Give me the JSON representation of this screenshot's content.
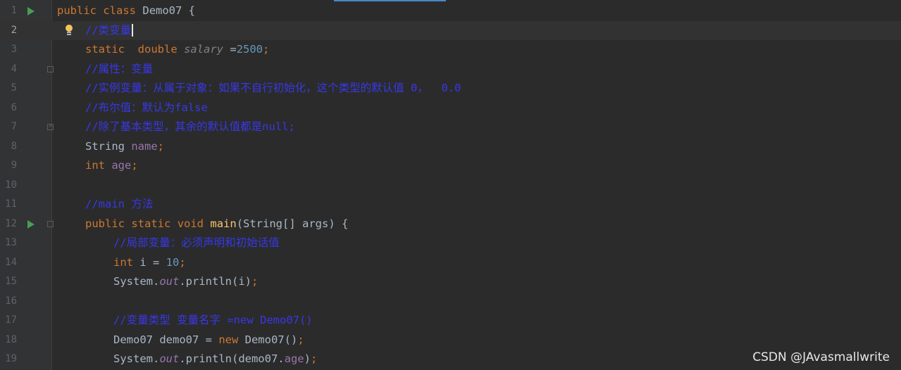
{
  "editor": {
    "current_line": 2,
    "lines": [
      {
        "n": "1"
      },
      {
        "n": "2"
      },
      {
        "n": "3"
      },
      {
        "n": "4"
      },
      {
        "n": "5"
      },
      {
        "n": "6"
      },
      {
        "n": "7"
      },
      {
        "n": "8"
      },
      {
        "n": "9"
      },
      {
        "n": "10"
      },
      {
        "n": "11"
      },
      {
        "n": "12"
      },
      {
        "n": "13"
      },
      {
        "n": "14"
      },
      {
        "n": "15"
      },
      {
        "n": "16"
      },
      {
        "n": "17"
      },
      {
        "n": "18"
      },
      {
        "n": "19"
      }
    ],
    "tokens": {
      "l1": [
        "public",
        "class",
        "Demo07 {"
      ],
      "l2": [
        "//类变量"
      ],
      "l3": [
        "static",
        "double",
        "salary",
        " =",
        "2500",
        ";"
      ],
      "l4": [
        "//属性：变量"
      ],
      "l5": [
        "//实例变量：从属于对象：如果不自行初始化，这个类型的默认值 0，  0.0"
      ],
      "l6": [
        "//布尔值：默认为false"
      ],
      "l7": [
        "//除了基本类型，其余的默认值都是null;"
      ],
      "l8": [
        "String ",
        "name",
        ";"
      ],
      "l9": [
        "int",
        "age",
        ";"
      ],
      "l11": [
        "//main 方法"
      ],
      "l12": [
        "public",
        "static",
        "void",
        "main",
        "(String[] args) {"
      ],
      "l13": [
        "//局部变量：必须声明和初始话值"
      ],
      "l14": [
        "int",
        "i = ",
        "10",
        ";"
      ],
      "l15": [
        "System.",
        "out",
        ".println(i)",
        ";"
      ],
      "l17": [
        "//变量类型 变量名字 =new Demo07()"
      ],
      "l18": [
        "Demo07 demo07 = ",
        "new",
        " Demo07()",
        ";"
      ],
      "l19": [
        "System.",
        "out",
        ".println(demo07.",
        "age",
        ")",
        ";"
      ]
    }
  },
  "icons": {
    "run": "run-gutter-icon",
    "fold": "fold-icon",
    "intention": "lightbulb-icon"
  },
  "colors": {
    "background": "#2b2b2b",
    "keyword": "#cc7832",
    "comment": "#3838e8",
    "number": "#6897bb",
    "field": "#9876aa",
    "method": "#ffc66d",
    "run": "#499c54"
  },
  "watermark": "CSDN @JAvasmallwrite"
}
